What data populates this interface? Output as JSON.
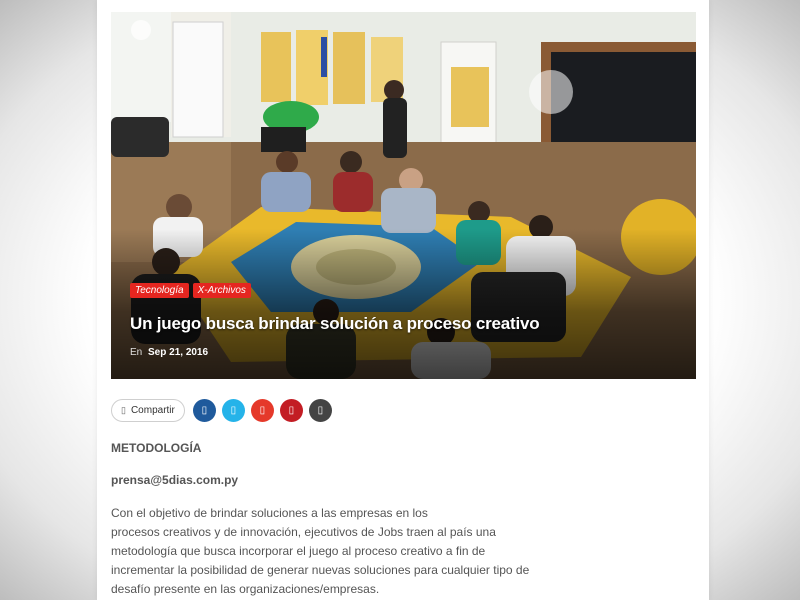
{
  "article": {
    "categories": [
      "Tecnología",
      "X-Archivos"
    ],
    "title": "Un juego busca brindar solución a proceso creativo",
    "meta_prefix": "En",
    "date": "Sep 21, 2016"
  },
  "share": {
    "label": "Compartir",
    "icons": [
      "share-icon",
      "facebook-icon",
      "twitter-icon",
      "google-plus-icon",
      "pinterest-icon",
      "email-icon"
    ]
  },
  "content": {
    "section_heading": "METODOLOGÍA",
    "email": "prensa@5dias.com.py",
    "paragraph_lines": [
      "Con el objetivo de brindar soluciones a las empresas en los",
      "procesos creativos y de innovación, ejecutivos de Jobs traen al país una",
      "metodología que busca incorporar el juego al proceso creativo a fin de",
      "incrementar la posibilidad de generar nuevas soluciones para cualquier tipo de",
      "desafío presente en las organizaciones/empresas."
    ]
  },
  "colors": {
    "category_bg": "#e52620",
    "facebook": "#1f5a9c",
    "twitter": "#25b3e9",
    "google_plus": "#e5392a",
    "pinterest": "#c31d24",
    "email": "#444444",
    "text": "#555555"
  }
}
